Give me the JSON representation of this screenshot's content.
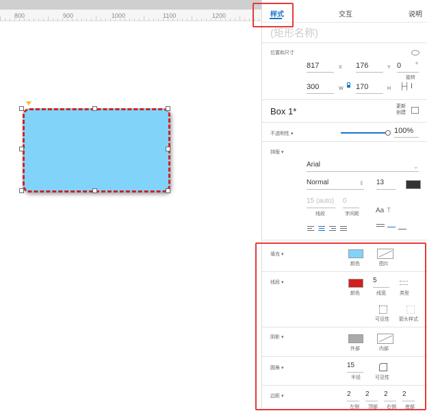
{
  "ruler": {
    "labels": [
      "800",
      "900",
      "1000",
      "1100",
      "1200"
    ]
  },
  "tabs": {
    "style": "样式",
    "interaction": "交互",
    "notes": "说明"
  },
  "shape_name_placeholder": "(矩形名称)",
  "position_size": {
    "label": "位置和尺寸",
    "x": "817",
    "x_label": "X",
    "y": "176",
    "y_label": "Y",
    "rotation": "0",
    "rotation_unit": "°",
    "rotation_label": "旋转",
    "width": "300",
    "width_label": "W",
    "height": "170",
    "height_label": "H"
  },
  "style_name": {
    "title": "Box 1*",
    "create_line1": "更新",
    "create_line2": "创建"
  },
  "opacity": {
    "label": "不透明性 ▾",
    "value": "100%",
    "level": 1.0
  },
  "typography": {
    "label": "排版 ▾",
    "font": "Arial",
    "weight": "Normal",
    "size": "13",
    "text_color": "#333333",
    "line_height": "15 (auto)",
    "line_height_label": "线段",
    "letter_spacing": "0",
    "letter_spacing_label": "字间距"
  },
  "fill": {
    "label": "填充 ▾",
    "color": "#81d3f9",
    "color_label": "颜色",
    "image_label": "图片"
  },
  "border": {
    "label": "线段 ▾",
    "color": "#d41f1f",
    "color_label": "颜色",
    "width": "5",
    "width_label": "线宽",
    "type_label": "类型",
    "visibility_label": "可见性",
    "arrow_label": "箭头样式"
  },
  "shadow": {
    "label": "阴影 ▾",
    "outer_label": "外部",
    "inner_label": "内部",
    "outer_color": "#aaaaaa"
  },
  "corner": {
    "label": "圆角 ▾",
    "radius": "15",
    "radius_label": "半径",
    "visibility_label": "可见性"
  },
  "padding": {
    "label": "边距 ▾",
    "left": "2",
    "left_label": "左侧",
    "top": "2",
    "top_label": "顶部",
    "right": "2",
    "right_label": "右侧",
    "bottom": "2",
    "bottom_label": "底部"
  }
}
